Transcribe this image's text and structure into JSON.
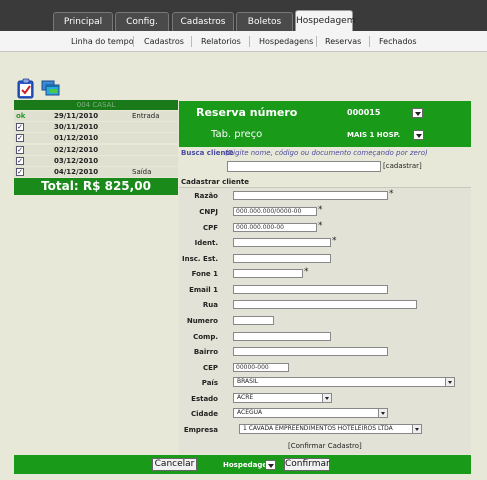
{
  "tabs": [
    "Principal",
    "Config.",
    "Cadastros",
    "Boletos",
    "Hospedagem"
  ],
  "submenu": [
    "Linha do tempo",
    "Cadastros",
    "Relatorios",
    "Hospedagens",
    "Reservas",
    "Fechados"
  ],
  "left": {
    "header": "004 CASAL",
    "rows": [
      {
        "status": "ok",
        "date": "29/11/2010",
        "tag": "Entrada"
      },
      {
        "status": "check",
        "date": "30/11/2010",
        "tag": ""
      },
      {
        "status": "check",
        "date": "01/12/2010",
        "tag": ""
      },
      {
        "status": "check",
        "date": "02/12/2010",
        "tag": ""
      },
      {
        "status": "check",
        "date": "03/12/2010",
        "tag": ""
      },
      {
        "status": "check",
        "date": "04/12/2010",
        "tag": "Saída"
      }
    ],
    "total": "Total: R$ 825,00"
  },
  "reserva": {
    "label": "Reserva número",
    "numero": "000015",
    "tab_label": "Tab. preço",
    "tab_value": "MAIS 1 HOSP."
  },
  "busca": {
    "label": "Busca cliente",
    "hint": "(Digite nome, código ou documento começando por zero)",
    "value": "",
    "button": "[cadastrar]"
  },
  "form": {
    "title": "Cadastrar cliente",
    "fields": {
      "razao": {
        "label": "Razão",
        "value": ""
      },
      "cnpj": {
        "label": "CNPJ",
        "value": "000.000.000/0000-00"
      },
      "cpf": {
        "label": "CPF",
        "value": "000.000.000-00"
      },
      "ident": {
        "label": "Ident.",
        "value": ""
      },
      "insc": {
        "label": "Insc. Est.",
        "value": ""
      },
      "fone": {
        "label": "Fone 1",
        "value": ""
      },
      "email": {
        "label": "Email 1",
        "value": ""
      },
      "rua": {
        "label": "Rua",
        "value": ""
      },
      "numero": {
        "label": "Numero",
        "value": ""
      },
      "comp": {
        "label": "Comp.",
        "value": ""
      },
      "bairro": {
        "label": "Bairro",
        "value": ""
      },
      "cep": {
        "label": "CEP",
        "value": "00000-000"
      },
      "pais": {
        "label": "País",
        "value": "BRASIL"
      },
      "estado": {
        "label": "Estado",
        "value": "ACRE"
      },
      "cidade": {
        "label": "Cidade",
        "value": "ACEGUA"
      },
      "empresa": {
        "label": "Empresa",
        "value": "1 CAVADA EMPREENDIMENTOS HOTELEIROS LTDA"
      }
    },
    "required_mark": "*",
    "confirm": "[Confirmar Cadastro]"
  },
  "bottom": {
    "cancel": "Cancelar",
    "select": "Hospedagem",
    "confirm": "Confirmar"
  },
  "colors": {
    "green": "#199a19",
    "dark_green": "#1a7a1a",
    "topbar": "#3a3a3a"
  }
}
